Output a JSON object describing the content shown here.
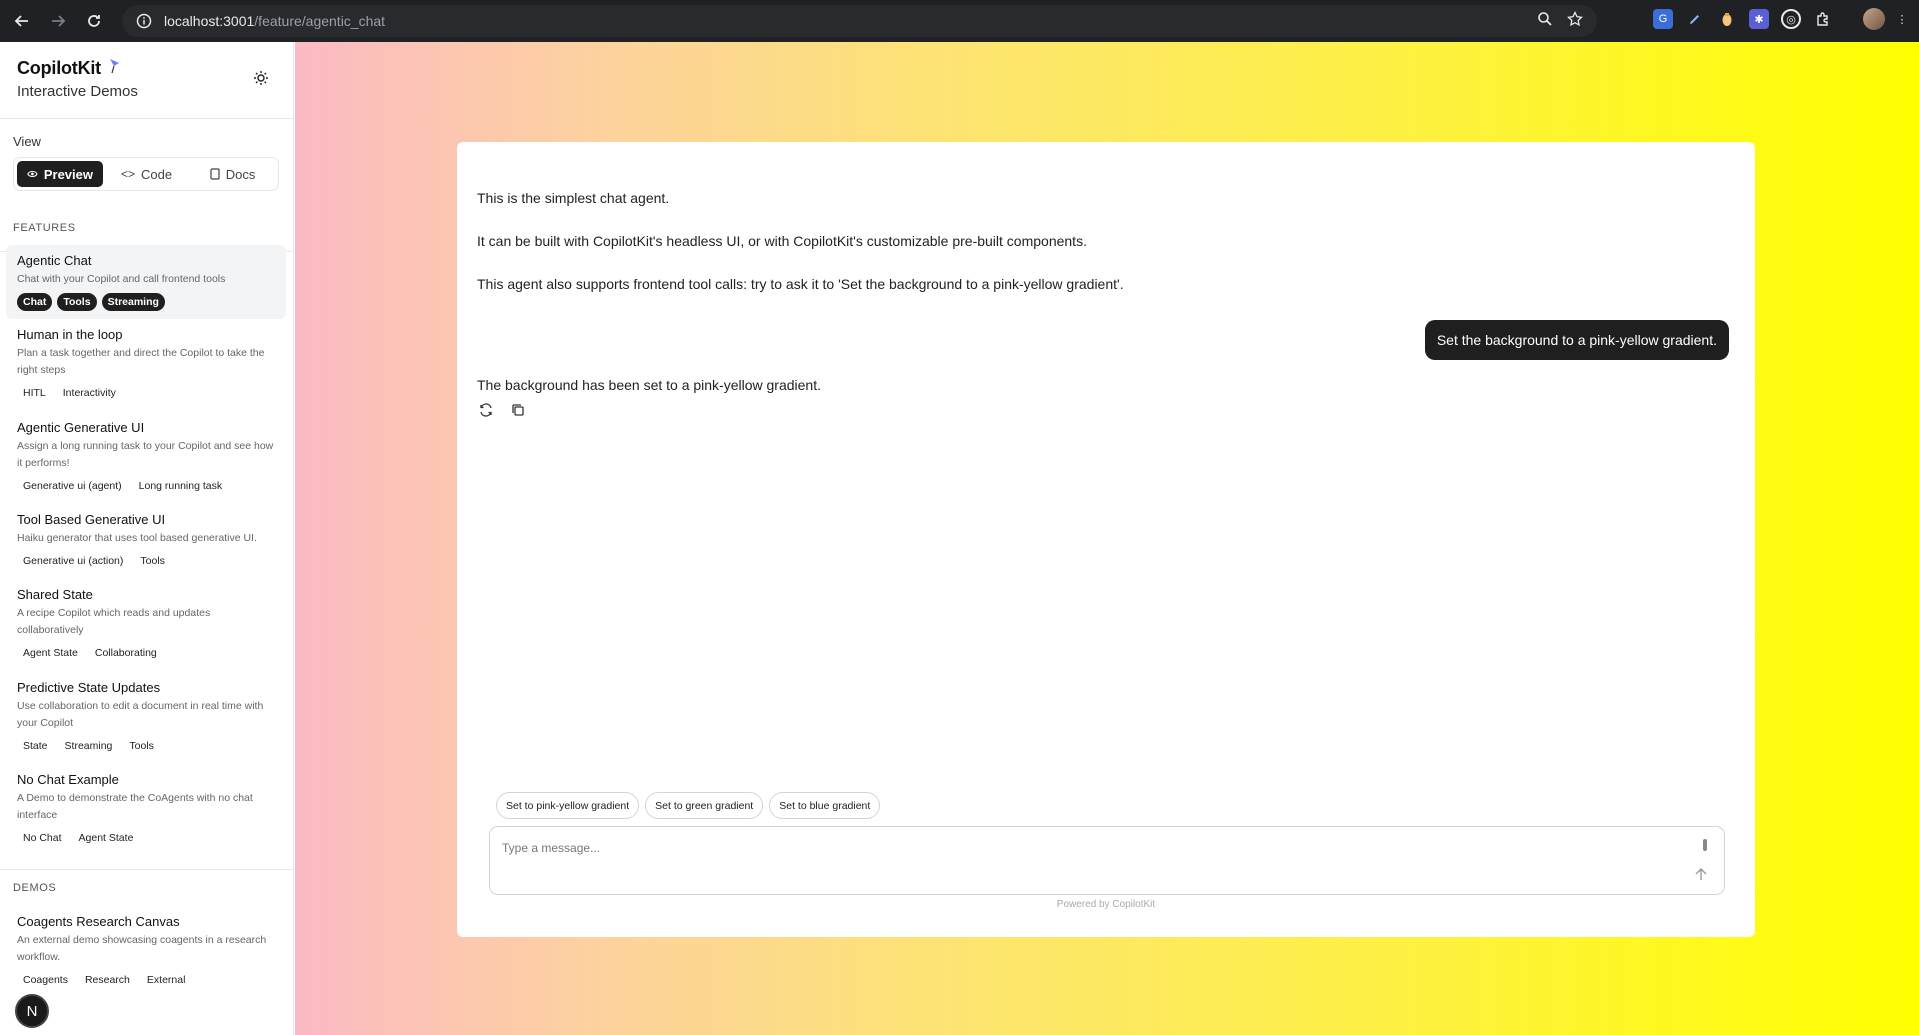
{
  "browser": {
    "url_host": "localhost:3001",
    "url_path": "/feature/agentic_chat"
  },
  "sidebar": {
    "brand_title": "CopilotKit",
    "brand_subtitle": "Interactive Demos",
    "view_label": "View",
    "view_tabs": [
      {
        "label": "Preview"
      },
      {
        "label": "Code"
      },
      {
        "label": "Docs"
      }
    ],
    "features_label": "FEATURES",
    "features": [
      {
        "title": "Agentic Chat",
        "desc": "Chat with your Copilot and call frontend tools",
        "tags": [
          "Chat",
          "Tools",
          "Streaming"
        ]
      },
      {
        "title": "Human in the loop",
        "desc": "Plan a task together and direct the Copilot to take the right steps",
        "tags": [
          "HITL",
          "Interactivity"
        ]
      },
      {
        "title": "Agentic Generative UI",
        "desc": "Assign a long running task to your Copilot and see how it performs!",
        "tags": [
          "Generative ui (agent)",
          "Long running task"
        ]
      },
      {
        "title": "Tool Based Generative UI",
        "desc": "Haiku generator that uses tool based generative UI.",
        "tags": [
          "Generative ui (action)",
          "Tools"
        ]
      },
      {
        "title": "Shared State",
        "desc": "A recipe Copilot which reads and updates collaboratively",
        "tags": [
          "Agent State",
          "Collaborating"
        ]
      },
      {
        "title": "Predictive State Updates",
        "desc": "Use collaboration to edit a document in real time with your Copilot",
        "tags": [
          "State",
          "Streaming",
          "Tools"
        ]
      },
      {
        "title": "No Chat Example",
        "desc": "A Demo to demonstrate the CoAgents with no chat interface",
        "tags": [
          "No Chat",
          "Agent State"
        ]
      }
    ],
    "demos_label": "DEMOS",
    "demos": [
      {
        "title": "Coagents Research Canvas",
        "desc": "An external demo showcasing coagents in a research workflow.",
        "tags": [
          "Coagents",
          "Research",
          "External"
        ]
      }
    ],
    "badge": "N"
  },
  "chat": {
    "assistant_intro": [
      "This is the simplest chat agent.",
      "It can be built with CopilotKit's headless UI, or with CopilotKit's customizable pre-built components.",
      "This agent also supports frontend tool calls: try to ask it to 'Set the background to a pink-yellow gradient'."
    ],
    "user_message": "Set the background to a pink-yellow gradient.",
    "assistant_reply": "The background has been set to a pink-yellow gradient.",
    "suggestions": [
      "Set to pink-yellow gradient",
      "Set to green gradient",
      "Set to blue gradient"
    ],
    "input_placeholder": "Type a message...",
    "powered_by": "Powered by CopilotKit"
  }
}
